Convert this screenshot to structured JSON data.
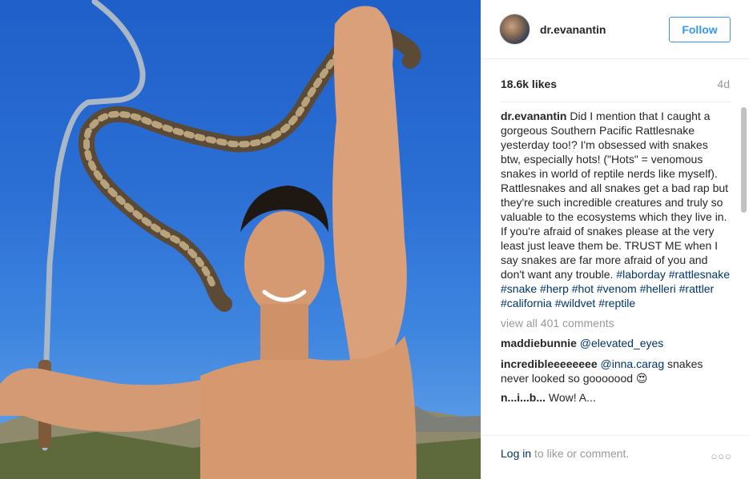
{
  "post": {
    "username": "dr.evanantin",
    "follow_label": "Follow",
    "likes": "18.6k likes",
    "age": "4d",
    "caption_text": "Did I mention that I caught a gorgeous Southern Pacific Rattlesnake yesterday too!? I'm obsessed with snakes btw, especially hots! (\"Hots\" = venomous snakes in world of reptile nerds like myself). Rattlesnakes and all snakes get a bad rap but they're such incredible creatures and truly so valuable to the ecosystems which they live in. If you're afraid of snakes please at the very least just leave them be. TRUST ME when I say snakes are far more afraid of you and don't want any trouble.",
    "hashtags": [
      "#laborday",
      "#rattlesnake",
      "#snake",
      "#herp",
      "#hot",
      "#venom",
      "#helleri",
      "#rattler",
      "#california",
      "#wildvet",
      "#reptile"
    ],
    "view_all": "view all 401 comments",
    "comments": [
      {
        "author": "maddiebunnie",
        "mention": "@elevated_eyes",
        "text": ""
      },
      {
        "author": "incredibleeeeeeee",
        "mention": "@inna.carag",
        "text": " snakes never looked so gooooood 😍"
      },
      {
        "author": "n...i...b...",
        "mention": "",
        "text": "Wow! A..."
      }
    ]
  },
  "footer": {
    "login_link": "Log in",
    "login_rest": " to like or comment.",
    "more_icon": "more-options-icon"
  }
}
